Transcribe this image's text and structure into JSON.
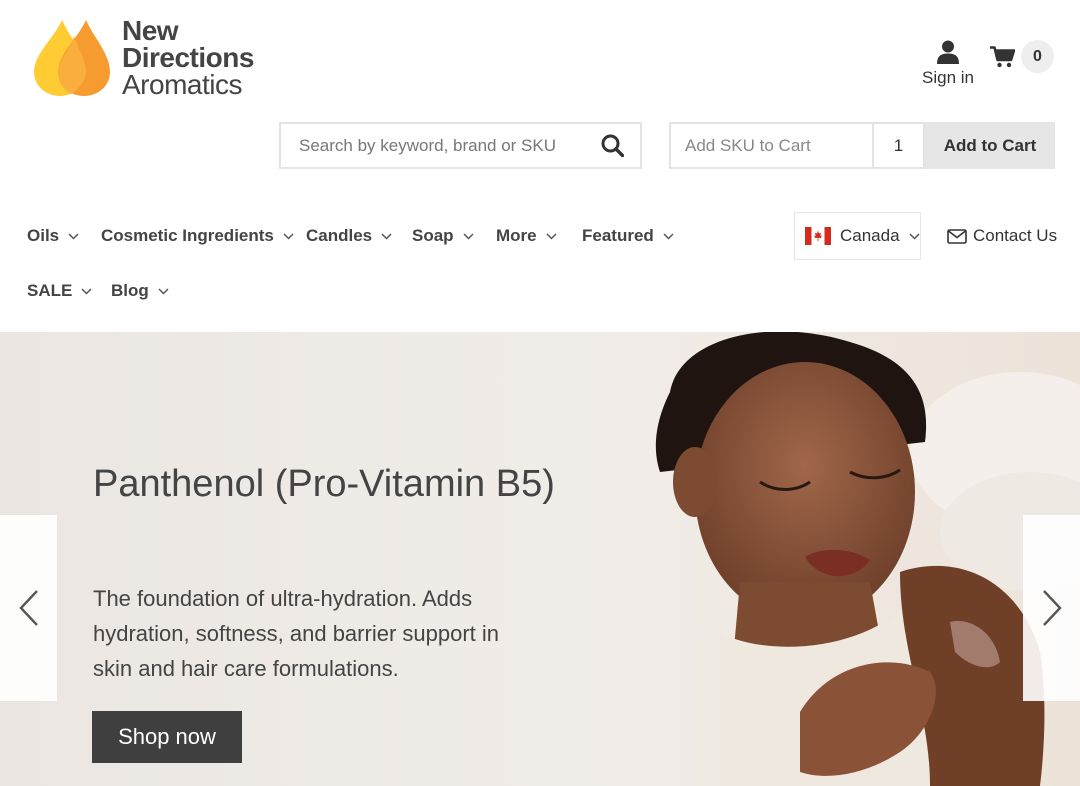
{
  "header": {
    "logo": {
      "line1": "New",
      "line2": "Directions",
      "line3": "Aromatics"
    },
    "sign_in_label": "Sign in",
    "cart_count": "0"
  },
  "search": {
    "placeholder": "Search by keyword, brand or SKU",
    "value": ""
  },
  "quick_add": {
    "sku_placeholder": "Add SKU to Cart",
    "quantity": "1",
    "button_label": "Add to Cart"
  },
  "nav": {
    "items": [
      {
        "label": "Oils"
      },
      {
        "label": "Cosmetic Ingredients"
      },
      {
        "label": "Candles"
      },
      {
        "label": "Soap"
      },
      {
        "label": "More"
      },
      {
        "label": "Featured"
      },
      {
        "label": "SALE"
      },
      {
        "label": "Blog"
      }
    ],
    "country": "Canada",
    "contact_label": "Contact Us"
  },
  "hero": {
    "title": "Panthenol (Pro-Vitamin B5)",
    "description": "The foundation of ultra-hydration. Adds hydration, softness, and barrier support in skin and hair care formulations.",
    "cta_label": "Shop now"
  },
  "icons": {
    "user": "user-icon",
    "cart": "cart-icon",
    "search": "search-icon",
    "chevron": "chevron-down-icon",
    "flag": "canada-flag-icon",
    "mail": "envelope-icon",
    "prev": "chevron-left-icon",
    "next": "chevron-right-icon"
  },
  "colors": {
    "logo_yellow": "#ffcc33",
    "logo_orange": "#f5931e",
    "text_dark": "#444444",
    "button_dark": "#3f3f3f",
    "button_light": "#e6e6e6",
    "canada_red": "#d52b1e"
  }
}
